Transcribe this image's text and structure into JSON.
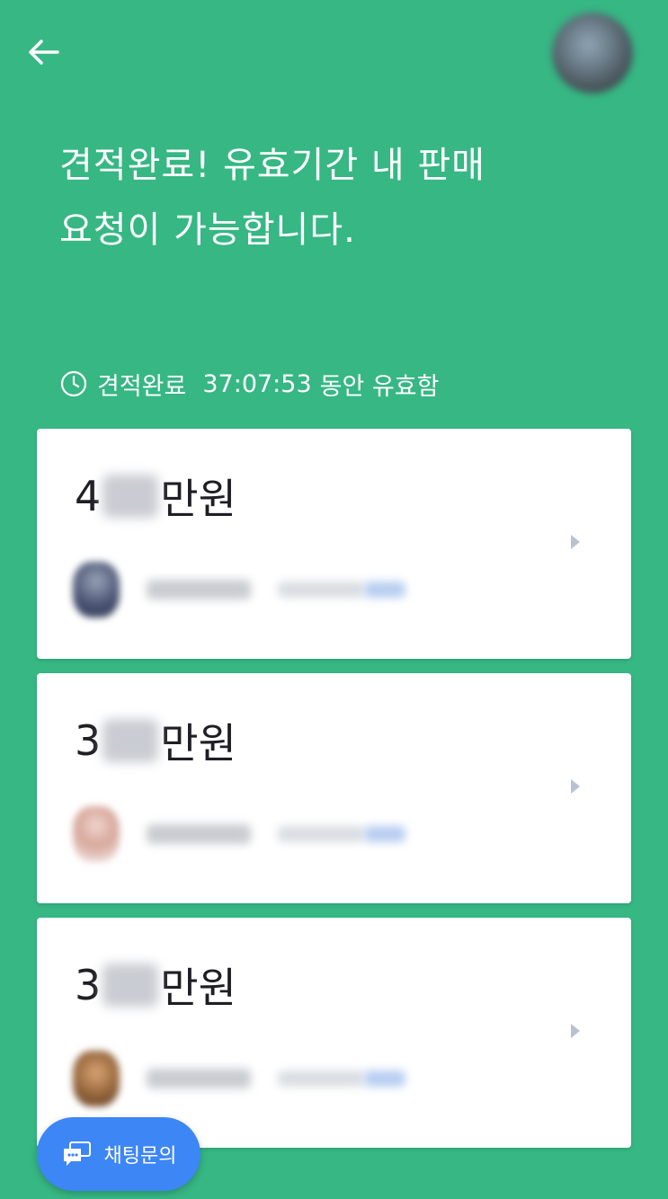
{
  "header": {
    "back_icon": "arrow-left-icon",
    "avatar_icon": "profile-avatar"
  },
  "headline": "견적완료! 유효기간 내 판매\n요청이 가능합니다.",
  "timer": {
    "icon": "clock-icon",
    "status": "견적완료",
    "countdown": "37:07:53",
    "suffix": "동안 유효함"
  },
  "offers": [
    {
      "price_first_digit": "4",
      "price_unit": "만원",
      "chevron_icon": "chevron-right-icon"
    },
    {
      "price_first_digit": "3",
      "price_unit": "만원",
      "chevron_icon": "chevron-right-icon"
    },
    {
      "price_first_digit": "3",
      "price_unit": "만원",
      "chevron_icon": "chevron-right-icon"
    }
  ],
  "chat_button": {
    "label": "채팅문의",
    "icon": "chat-bubble-icon"
  },
  "colors": {
    "background": "#36b784",
    "card": "#ffffff",
    "chat_button": "#3d86f5",
    "price_text": "#1e1e24",
    "chevron": "#b8c3d1"
  }
}
